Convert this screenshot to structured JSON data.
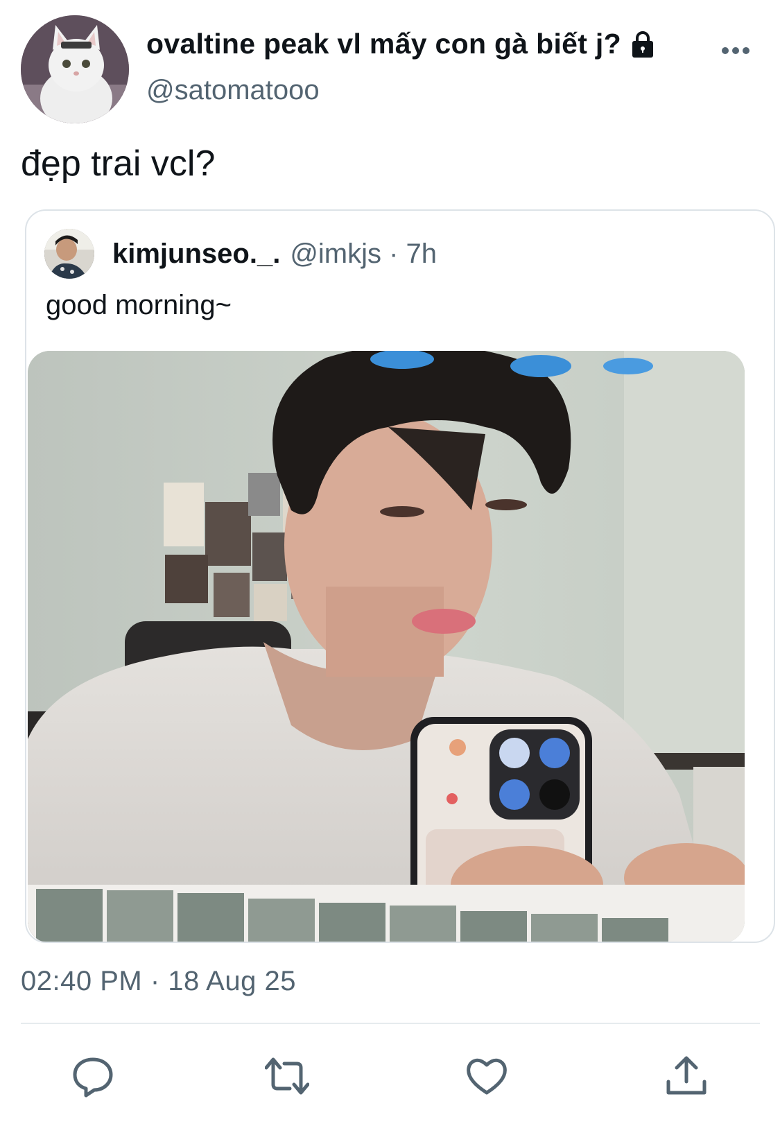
{
  "tweet": {
    "display_name": "ovaltine peak vl mấy con gà biết j?",
    "handle": "@satomatooo",
    "text": "đẹp trai vcl?",
    "timestamp": "02:40 PM · 18 Aug 25"
  },
  "quote": {
    "display_name": "kimjunseo._.",
    "meta": "@imkjs · 7h",
    "text": "good morning~"
  },
  "icons": {
    "lock": "lock-icon",
    "more": "more-icon",
    "reply": "reply-icon",
    "retweet": "retweet-icon",
    "like": "heart-icon",
    "share": "share-icon"
  },
  "colors": {
    "text_primary": "#0f1419",
    "text_secondary": "#536471",
    "icon": "#536471",
    "border": "#dde3e8"
  }
}
